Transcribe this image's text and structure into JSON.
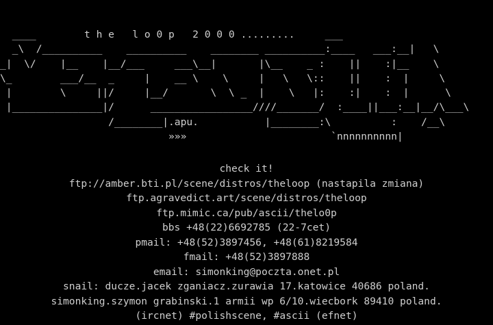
{
  "colors": {
    "background": "#000000",
    "text": "#cfcfcf"
  },
  "ascii_art": {
    "lines": [
      "  ____        t h e   l o 0 p   2 0 0 0 .........     ___",
      "  _\\  /__________    __________    ________ __________:____   ___:__|   \\",
      "_|  \\/    |__    |__/___     ___\\__|       |\\__    _ :    ||    :|__    \\",
      "\\_        ___/__  _     |    __ \\    \\     |   \\   \\::    ||    :  |     \\",
      " |        \\     ||/     |__/       \\  \\ _  |    \\   |:    :|    :  |      \\",
      " |_______________|/      _________________////_______/  :____||___:__|__/\\___\\",
      "                  /________|.apu.           |________:\\          :    /__\\",
      "                            »»»                        `nnnnnnnnnn|"
    ]
  },
  "info": {
    "lines": [
      "check it!",
      "ftp://amber.bti.pl/scene/distros/theloop (nastapila zmiana)",
      "ftp.agravedict.art/scene/distros/theloop",
      "ftp.mimic.ca/pub/ascii/thelo0p",
      "bbs +48(22)6692785 (22-7cet)",
      "pmail: +48(52)3897456, +48(61)8219584",
      "fmail: +48(52)3897888",
      "email: simonking@poczta.onet.pl",
      "snail: ducze.jacek zganiacz.zurawia 17.katowice 40686 poland.",
      "simonking.szymon grabinski.1 armii wp 6/10.wiecbork 89410 poland.",
      "(ircnet) #polishscene, #ascii (efnet)"
    ]
  }
}
